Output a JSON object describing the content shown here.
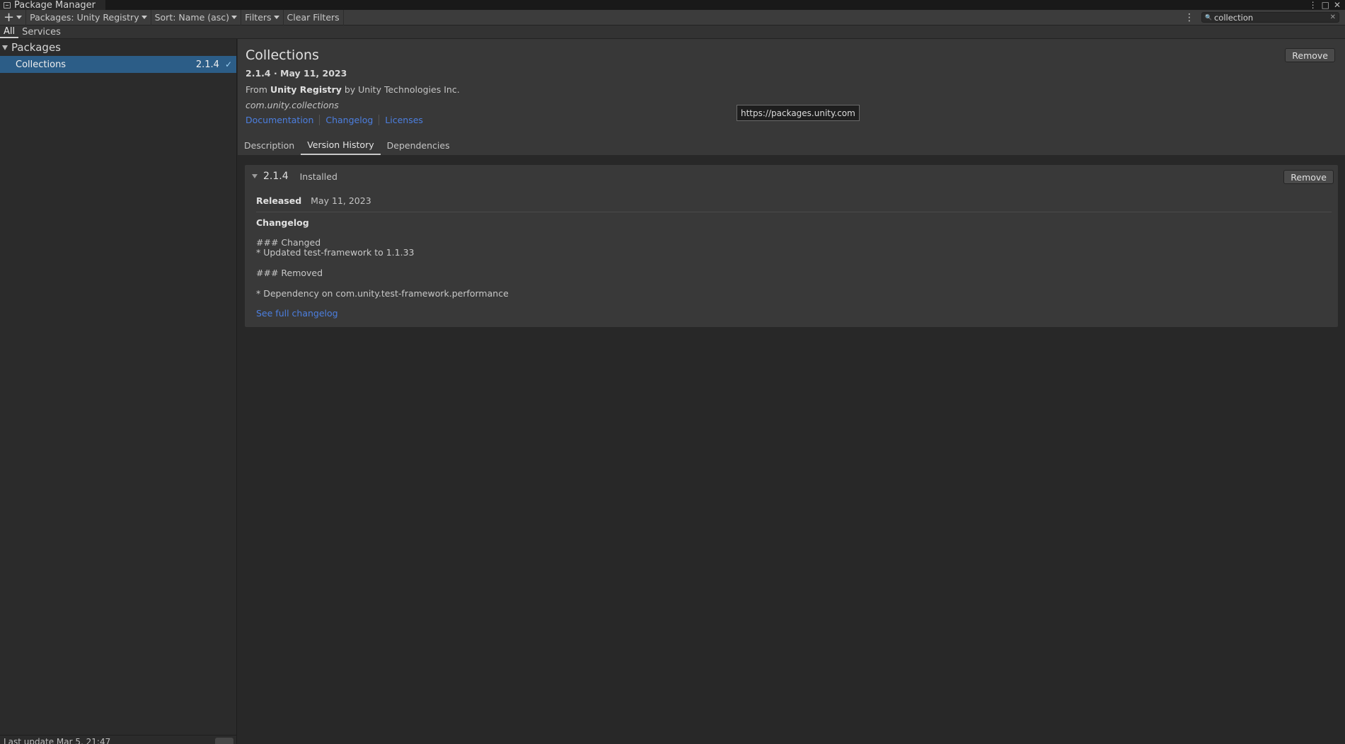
{
  "window": {
    "title": "Package Manager",
    "controls": [
      "⋮",
      "□",
      "✕"
    ]
  },
  "toolbar": {
    "add_label": "+",
    "packages_label": "Packages: Unity Registry",
    "sort_label": "Sort: Name (asc)",
    "filters_label": "Filters",
    "clear_filters_label": "Clear Filters",
    "search_value": "collection"
  },
  "tabs": [
    {
      "label": "All",
      "active": true
    },
    {
      "label": "Services",
      "active": false
    }
  ],
  "sidebar": {
    "group_label": "Packages",
    "items": [
      {
        "name": "Collections",
        "version": "2.1.4",
        "selected": true,
        "installed": true
      }
    ],
    "status_text": "Last update Mar 5, 21:47"
  },
  "details": {
    "title": "Collections",
    "subtitle": "2.1.4 · May 11, 2023",
    "from_prefix": "From",
    "registry": "Unity Registry",
    "by_text": "by Unity Technologies Inc.",
    "package_id": "com.unity.collections",
    "links": [
      "Documentation",
      "Changelog",
      "Licenses"
    ],
    "tooltip": "https://packages.unity.com",
    "remove_label": "Remove",
    "tabs": [
      {
        "label": "Description",
        "active": false
      },
      {
        "label": "Version History",
        "active": true
      },
      {
        "label": "Dependencies",
        "active": false
      }
    ]
  },
  "version_card": {
    "version": "2.1.4",
    "status": "Installed",
    "remove_label": "Remove",
    "released_label": "Released",
    "released_date": "May 11, 2023",
    "changelog_title": "Changelog",
    "changelog_lines": [
      "### Changed",
      "* Updated test-framework to 1.1.33",
      "### Removed",
      "* Dependency on com.unity.test-framework.performance"
    ],
    "full_changelog_link": "See full changelog"
  },
  "colors": {
    "selection": "#2c5d87",
    "link": "#4c7fe0",
    "panel": "#383838"
  }
}
